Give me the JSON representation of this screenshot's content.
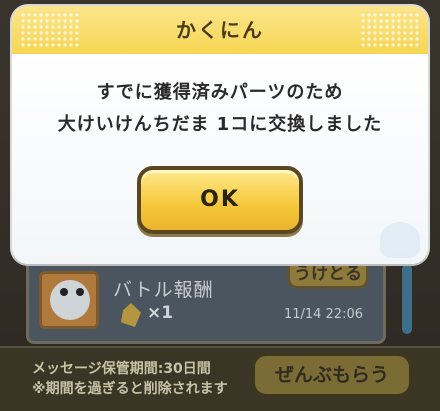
{
  "dialog": {
    "title": "かくにん",
    "message_line1": "すでに獲得済みパーツのため",
    "message_line2": "大けいけんちだま 1コに交換しました",
    "ok_label": "OK"
  },
  "background": {
    "mail": {
      "title": "バトル報酬",
      "receive_label": "うけとる",
      "reward_count": "×1",
      "timestamp": "11/14 22:06"
    },
    "footer": {
      "storage_note": "メッセージ保管期間:30日間",
      "deletion_note": "※期間を過ぎると削除されます",
      "receive_all_label": "ぜんぶもらう"
    }
  },
  "colors": {
    "header_yellow": "#f6d653",
    "ok_button": "#f6c73a",
    "dim_background": "#2b2720"
  }
}
